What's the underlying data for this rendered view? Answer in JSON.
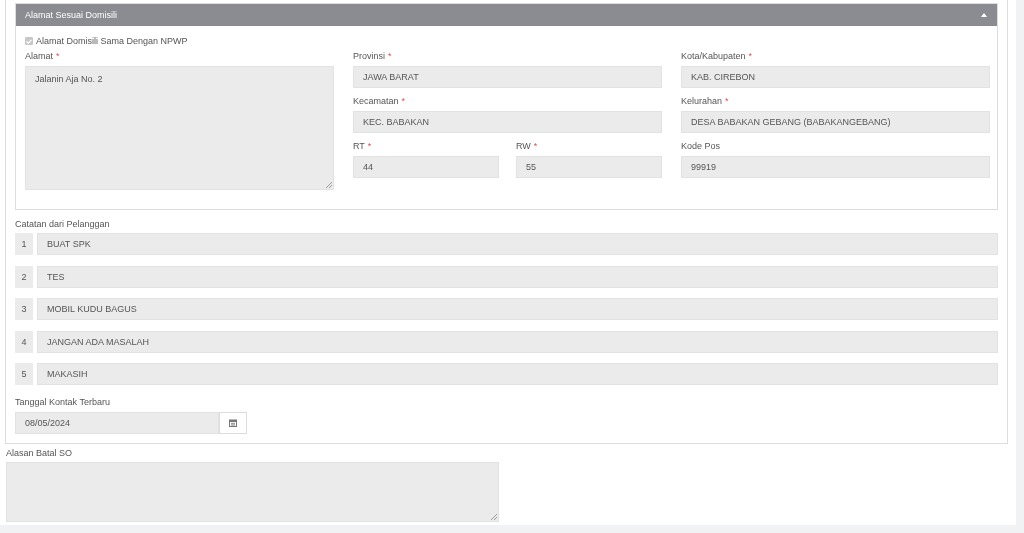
{
  "panel": {
    "title": "Alamat Sesuai Domisili",
    "expanded": true
  },
  "same_as_npwp": {
    "label": "Alamat Domisili Sama Dengan NPWP",
    "checked": true,
    "disabled": true
  },
  "address": {
    "label": "Alamat",
    "required_mark": "*",
    "value": "Jalanin Aja No. 2"
  },
  "fields": [
    {
      "label": "Provinsi",
      "required_mark": "*",
      "value": "JAWA BARAT"
    },
    {
      "label": "Kota/Kabupaten",
      "required_mark": "*",
      "value": "KAB. CIREBON"
    },
    {
      "label": "Kecamatan",
      "required_mark": "*",
      "value": "KEC. BABAKAN"
    },
    {
      "label": "Kelurahan",
      "required_mark": "*",
      "value": "DESA BABAKAN GEBANG (BABAKANGEBANG)"
    },
    {
      "label": "RT",
      "required_mark": "*",
      "value": "44"
    },
    {
      "label": "RW",
      "required_mark": "*",
      "value": "55"
    },
    {
      "label": "Kode Pos",
      "value": "99919"
    }
  ],
  "notes": {
    "label": "Catatan dari Pelanggan",
    "items": [
      {
        "number": "1",
        "value": "BUAT SPK"
      },
      {
        "number": "2",
        "value": "TES"
      },
      {
        "number": "3",
        "value": "MOBIL KUDU BAGUS"
      },
      {
        "number": "4",
        "value": "JANGAN ADA MASALAH"
      },
      {
        "number": "5",
        "value": "MAKASIH"
      }
    ]
  },
  "last_contact": {
    "label": "Tanggal Kontak Terbaru",
    "value": "08/05/2024"
  },
  "cancel_reason": {
    "label": "Alasan Batal SO"
  }
}
